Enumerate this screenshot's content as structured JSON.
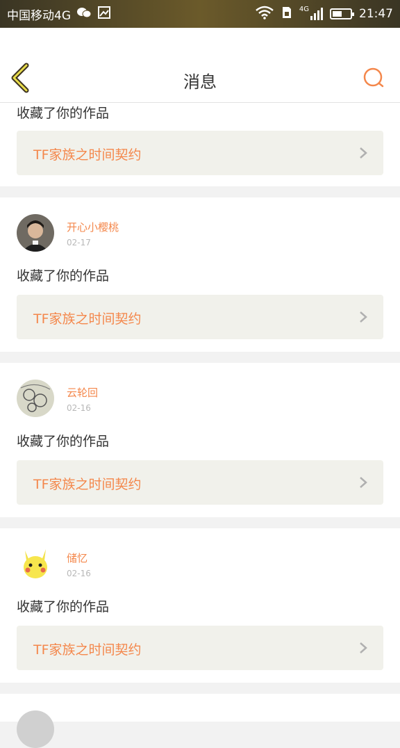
{
  "status_bar": {
    "carrier": "中国移动4G",
    "network_tag": "4G",
    "time": "21:47"
  },
  "header": {
    "title": "消息",
    "back_icon": "chevron-left-icon",
    "search_icon": "search-icon",
    "accent_color": "#f4874b"
  },
  "messages": [
    {
      "action": "收藏了你的作品",
      "work_title": "TF家族之时间契约"
    },
    {
      "username": "开心小樱桃",
      "date": "02-17",
      "action": "收藏了你的作品",
      "work_title": "TF家族之时间契约"
    },
    {
      "username": "云轮回",
      "date": "02-16",
      "action": "收藏了你的作品",
      "work_title": "TF家族之时间契约"
    },
    {
      "username": "储忆",
      "date": "02-16",
      "action": "收藏了你的作品",
      "work_title": "TF家族之时间契约"
    }
  ]
}
